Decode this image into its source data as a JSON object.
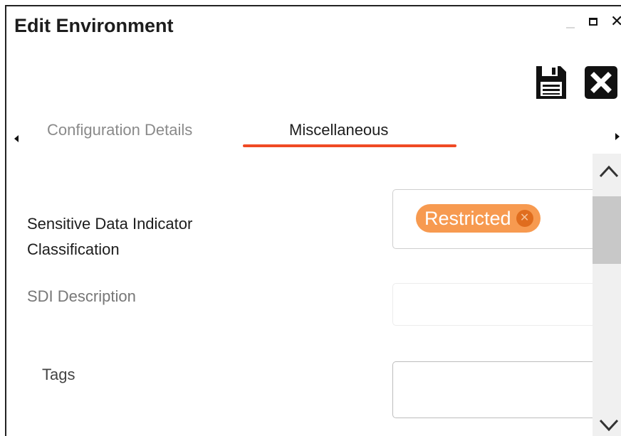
{
  "window": {
    "title": "Edit Environment",
    "minimize_icon": "minimize-icon",
    "maximize_icon": "maximize-icon",
    "close_glyph": "✕"
  },
  "toolbar": {
    "save_icon": "floppy-disk-icon",
    "close_icon": "close-square-icon"
  },
  "tabs": [
    {
      "label": "Configuration Details",
      "active": false
    },
    {
      "label": "Miscellaneous",
      "active": true
    }
  ],
  "colors": {
    "tab_active_underline": "#f04a24",
    "chip_background": "#f79a50",
    "chip_remove": "#e06d1e"
  },
  "form": {
    "sdi_classification": {
      "label": "Sensitive Data Indicator Classification",
      "chips": [
        {
          "label": "Restricted",
          "remove_glyph": "✕"
        }
      ]
    },
    "sdi_description": {
      "label": "SDI Description",
      "value": ""
    },
    "tags": {
      "label": "Tags",
      "value": ""
    }
  }
}
